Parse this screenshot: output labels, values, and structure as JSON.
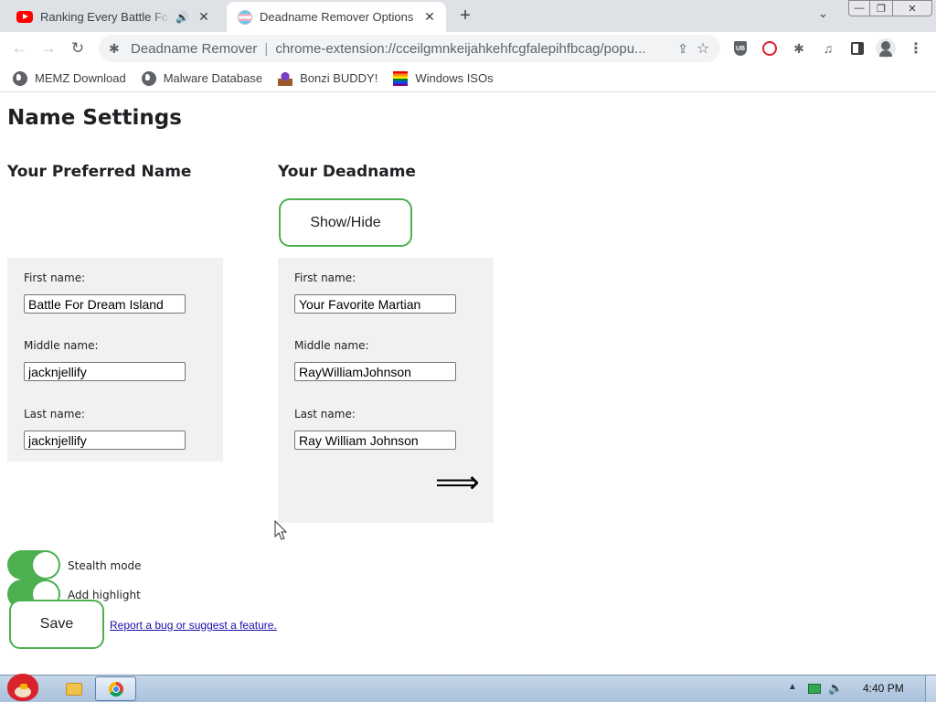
{
  "browser": {
    "tabs": [
      {
        "title": "Ranking Every Battle For Dream Island",
        "icon": "youtube-icon",
        "audio_icon": "🔊",
        "close": "✕"
      },
      {
        "title": "Deadname Remover Options",
        "icon": "transgender-flag-icon",
        "close": "✕"
      }
    ],
    "new_tab_label": "+",
    "tab_search_icon": "⌄",
    "window_controls": {
      "minimize": "—",
      "maximize": "❐",
      "close": "✕"
    },
    "nav": {
      "back": "←",
      "forward": "→",
      "reload": "↻"
    },
    "omnibox": {
      "extension_icon": "✱",
      "site_name": "Deadname Remover",
      "separator": "|",
      "url": "chrome-extension://cceilgmnkeijahkehfcgfalepihfbcag/popu...",
      "share_icon": "⇪",
      "star_icon": "☆"
    },
    "toolbar_icons": {
      "ublock": "UB",
      "puzzle": "✱",
      "media": "♫",
      "menu": "⋮"
    },
    "bookmarks": [
      {
        "label": "MEMZ Download",
        "icon": "globe-icon"
      },
      {
        "label": "Malware Database",
        "icon": "globe-icon"
      },
      {
        "label": "Bonzi BUDDY!",
        "icon": "bonzi-icon"
      },
      {
        "label": "Windows ISOs",
        "icon": "rainbow-flag-icon"
      }
    ]
  },
  "page": {
    "title": "Name Settings",
    "preferred": {
      "heading": "Your Preferred Name",
      "first_label": "First name:",
      "first_value": "Battle For Dream Island",
      "middle_label": "Middle name:",
      "middle_value": "jacknjellify",
      "last_label": "Last name:",
      "last_value": "jacknjellify"
    },
    "deadname": {
      "heading": "Your Deadname",
      "show_hide_label": "Show/Hide",
      "first_label": "First name:",
      "first_value": "Your Favorite Martian",
      "middle_label": "Middle name:",
      "middle_value": "RayWilliamJohnson",
      "last_label": "Last name:",
      "last_value": "Ray William Johnson",
      "arrow": "⟹"
    },
    "options": {
      "stealth_label": "Stealth mode",
      "stealth_on": true,
      "highlight_label": "Add highlight",
      "highlight_on": true
    },
    "save_label": "Save",
    "report_link": "Report a bug or suggest a feature."
  },
  "taskbar": {
    "clock": "4:40 PM",
    "tray_arrow": "▲",
    "volume_icon": "🔈"
  },
  "colors": {
    "accent_green": "#4caf50",
    "panel_bg": "#f1f1f1",
    "tab_strip": "#dee1e6"
  }
}
